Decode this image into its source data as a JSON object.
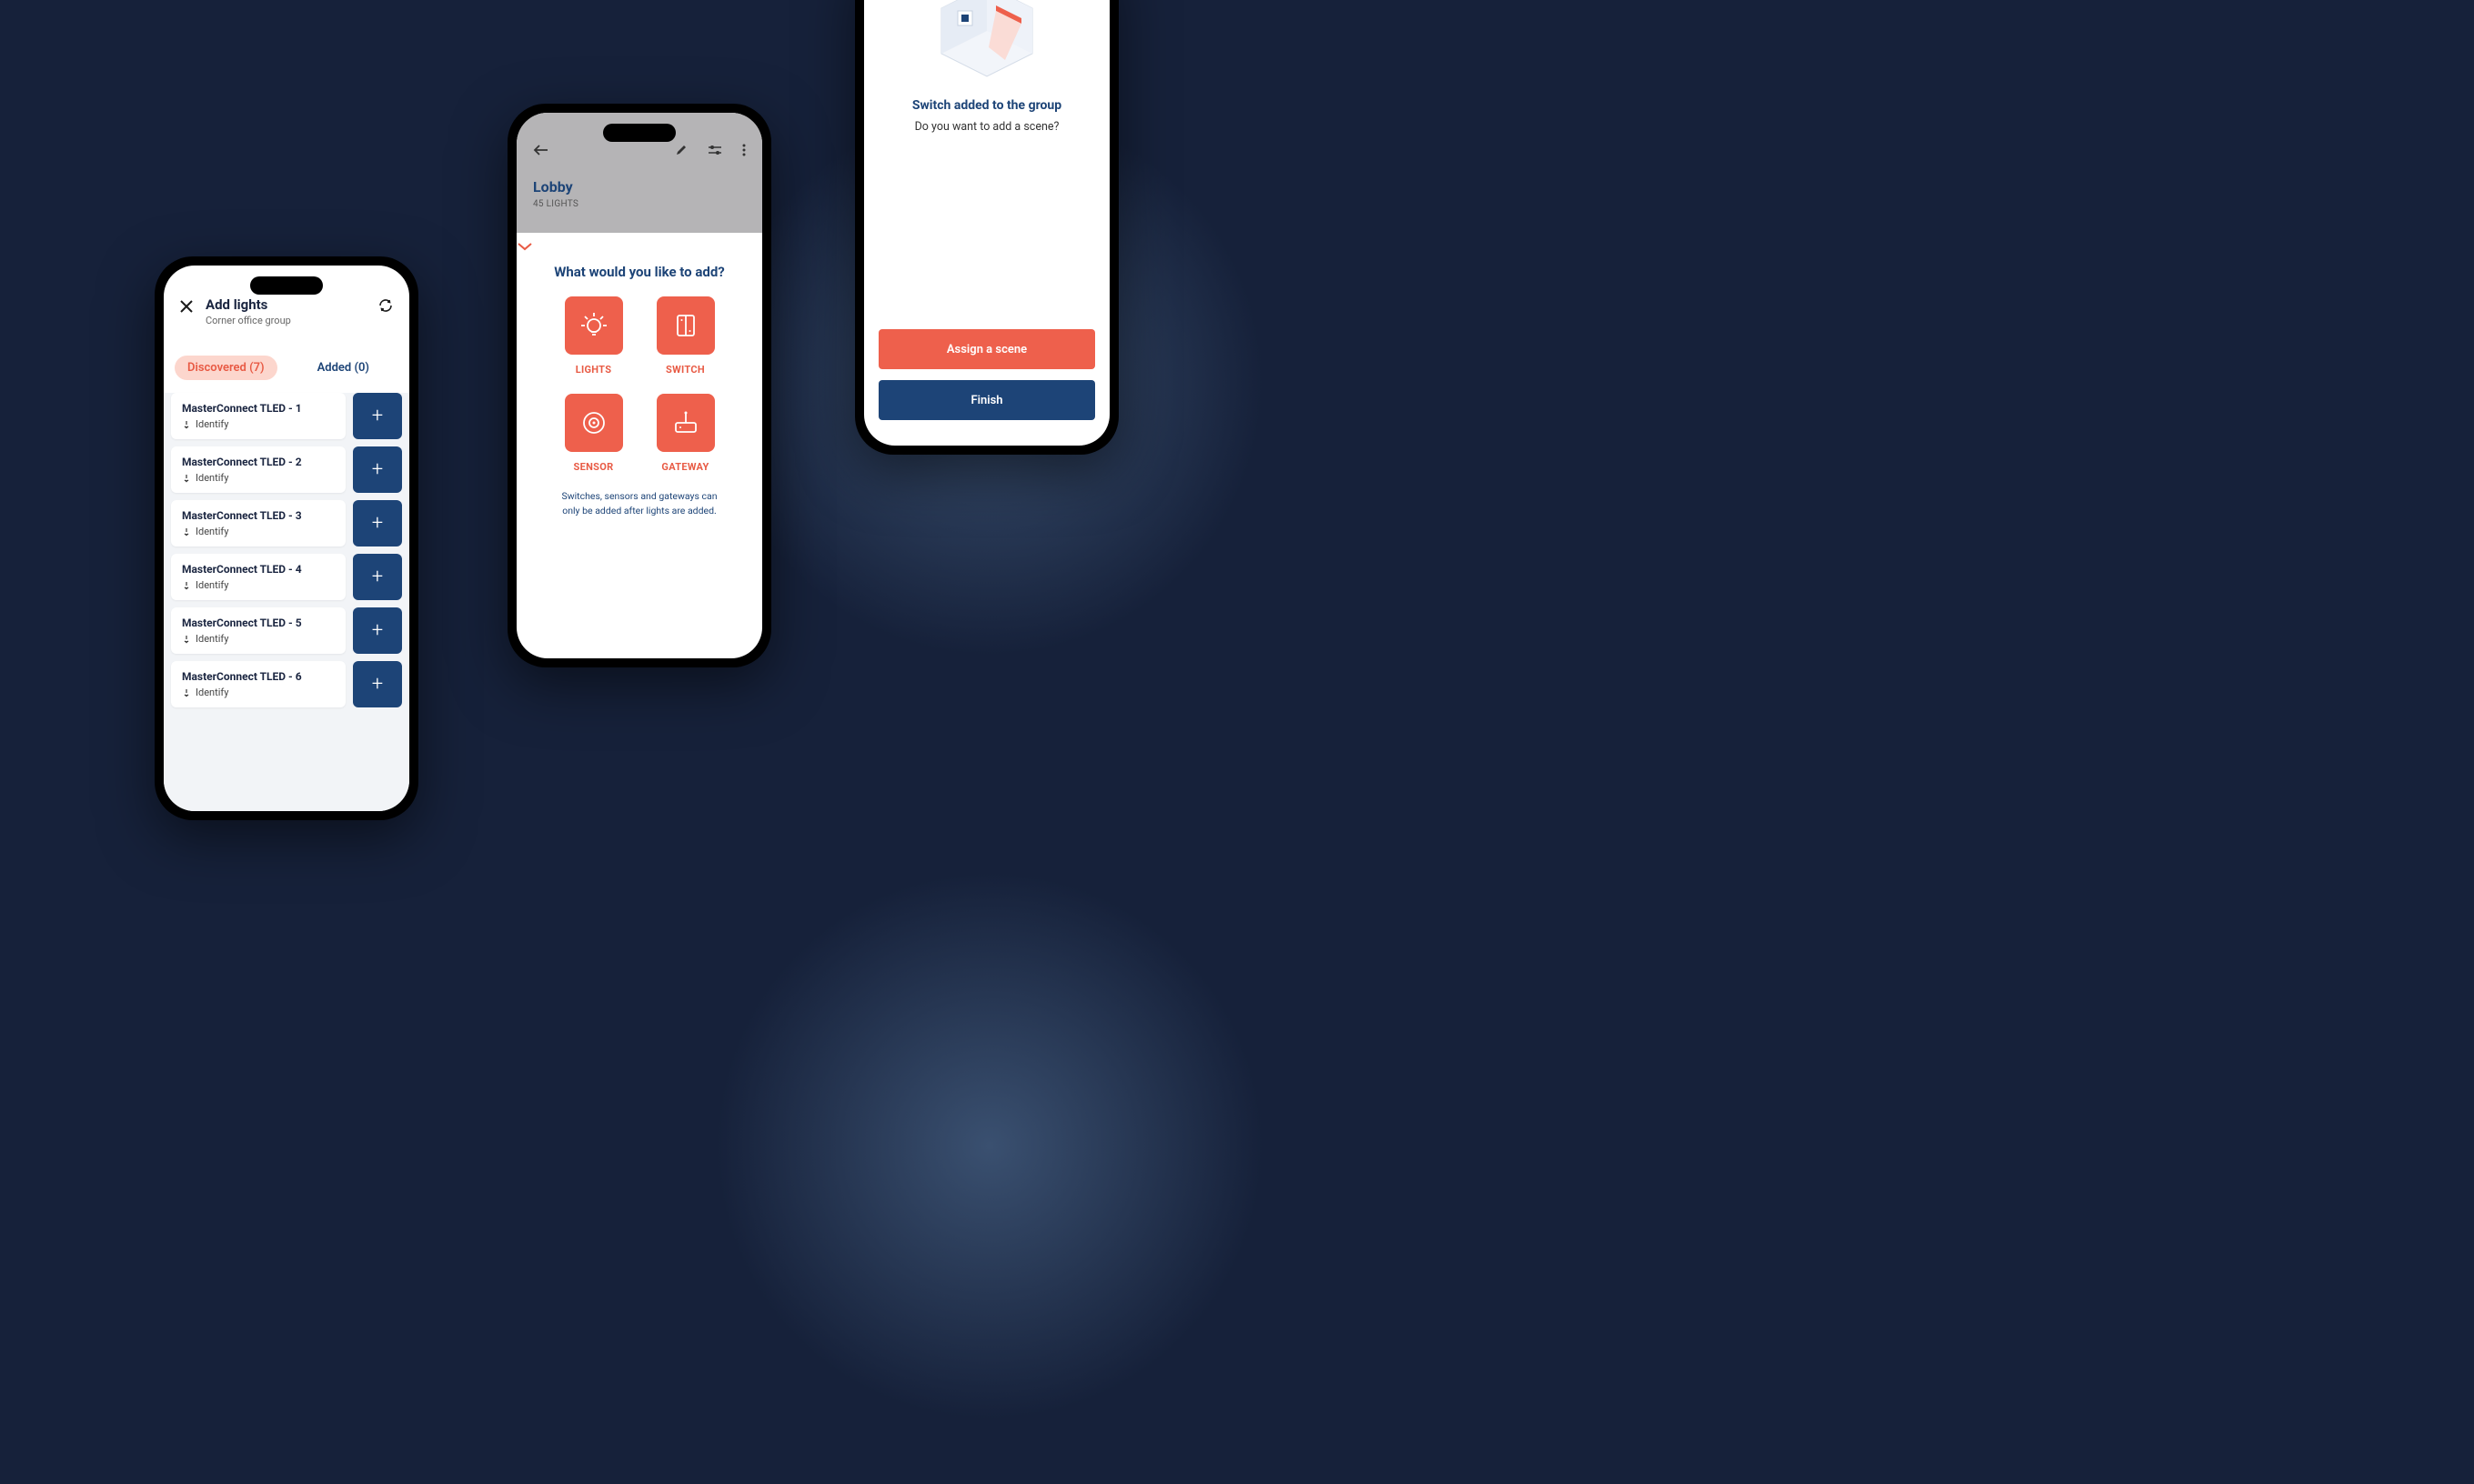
{
  "phone1": {
    "title": "Add lights",
    "subtitle": "Corner office group",
    "tabs": {
      "discovered": "Discovered (7)",
      "added": "Added (0)"
    },
    "identify_label": "Identify",
    "items": [
      {
        "name": "MasterConnect TLED - 1"
      },
      {
        "name": "MasterConnect TLED - 2"
      },
      {
        "name": "MasterConnect TLED - 3"
      },
      {
        "name": "MasterConnect TLED - 4"
      },
      {
        "name": "MasterConnect TLED - 5"
      },
      {
        "name": "MasterConnect TLED - 6"
      }
    ]
  },
  "phone2": {
    "title": "Lobby",
    "subtitle": "45 LIGHTS",
    "question": "What would you like to add?",
    "tiles": {
      "lights": "LIGHTS",
      "switch": "SWITCH",
      "sensor": "SENSOR",
      "gateway": "GATEWAY"
    },
    "note": "Switches, sensors and gateways can only be added after lights are added."
  },
  "phone3": {
    "title": "Switch added to the group",
    "subtitle": "Do you want to add a scene?",
    "assign": "Assign a scene",
    "finish": "Finish"
  }
}
